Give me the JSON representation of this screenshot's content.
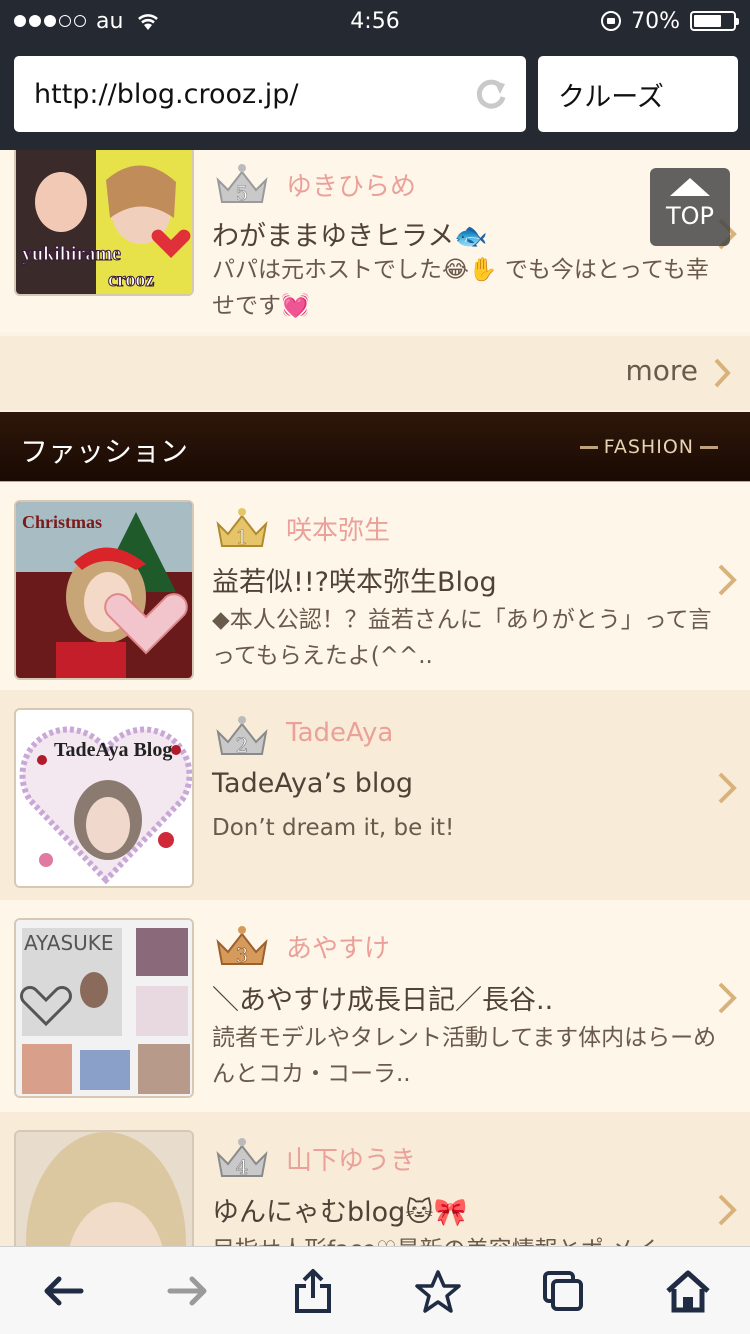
{
  "status_bar": {
    "carrier": "au",
    "time": "4:56",
    "battery": "70%",
    "battery_level": 0.7
  },
  "browser": {
    "url": "http://blog.crooz.jp/",
    "search_text": "クルーズ"
  },
  "top_button": {
    "label": "TOP"
  },
  "previous_entry": {
    "rank": "5",
    "author": "ゆきひらめ",
    "title": "わがままゆきヒラメ🐟",
    "description": "パパは元ホストでした😂✋ でも今はとっても幸せです💓"
  },
  "more_link": {
    "label": "more"
  },
  "section": {
    "title": "ファッション",
    "subtitle": "FASHION"
  },
  "entries": [
    {
      "rank": "1",
      "author": "咲本弥生",
      "title": "益若似!!?咲本弥生Blog",
      "description": "◆本人公認！？益若さんに「ありがとう」って言ってもらえたよ(^^..",
      "thumb_label": "Christmas"
    },
    {
      "rank": "2",
      "author": "TadeAya",
      "title": "TadeAya’s blog",
      "description": "Don’t dream it, be it!",
      "thumb_label": "TadeAya Blog"
    },
    {
      "rank": "3",
      "author": "あやすけ",
      "title": "＼あやすけ成長日記／長谷..",
      "description": "読者モデルやタレント活動してます体内はらーめんとコカ・コーラ..",
      "thumb_label": "AYASUKE"
    },
    {
      "rank": "4",
      "author": "山下ゆうき",
      "title": "ゆんにゃむblog🐱🎀",
      "description": "目指せ人形face♡最新の美容情報とポ.メイ..",
      "thumb_label": ""
    }
  ],
  "colors": {
    "chrome": "#252932",
    "section_bg": "#1a0a03",
    "author": "#eaa19a",
    "chevron": "#d8b27a",
    "toolbar_icon": "#1f2c44"
  },
  "toolbar": {
    "icons": [
      "back-arrow-icon",
      "forward-arrow-icon",
      "share-icon",
      "bookmark-star-icon",
      "tabs-icon",
      "home-icon"
    ]
  }
}
